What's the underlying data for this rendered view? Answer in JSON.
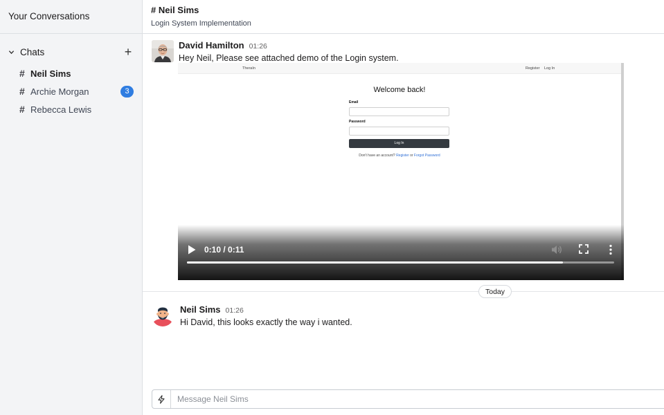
{
  "sidebar": {
    "title": "Your Conversations",
    "section_label": "Chats",
    "chats": [
      {
        "hash": "#",
        "name": "Neil Sims",
        "active": true,
        "unread": ""
      },
      {
        "hash": "#",
        "name": "Archie Morgan",
        "active": false,
        "unread": "3"
      },
      {
        "hash": "#",
        "name": "Rebecca Lewis",
        "active": false,
        "unread": ""
      }
    ]
  },
  "channel": {
    "title": "# Neil Sims",
    "subtitle": "Login System Implementation"
  },
  "messages": [
    {
      "author": "David Hamilton",
      "time": "01:26",
      "text": "Hey Neil, Please see attached demo of the Login system.",
      "avatar": "person-photo"
    },
    {
      "author": "Neil Sims",
      "time": "01:26",
      "text": "Hi David, this looks exactly the way i wanted.",
      "avatar": "bearded-man-illustration"
    }
  ],
  "video": {
    "time_display": "0:10 / 0:11",
    "progress_fraction": 0.88,
    "page": {
      "brand": "TheraIn",
      "nav_register": "Register",
      "nav_login": "Log In",
      "heading": "Welcome back!",
      "email_label": "Email",
      "password_label": "Password",
      "button_label": "Log In",
      "footer_text": "Don't have an account?",
      "footer_register": "Register",
      "footer_or": "or",
      "footer_forgot": "Forgot Password"
    }
  },
  "divider_label": "Today",
  "composer": {
    "placeholder": "Message Neil Sims",
    "value": ""
  },
  "colors": {
    "badge": "#2f7de1",
    "sidebar_bg": "#f3f4f6"
  },
  "icons": {
    "chevron": "chevron-down-icon",
    "add": "plus-icon",
    "composer": "bolt-icon"
  }
}
